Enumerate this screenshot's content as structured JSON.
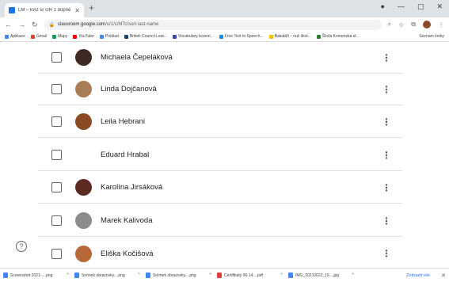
{
  "browser": {
    "tab_title": "LM – kvíz 5/ GR 1 dopne t",
    "address_host": "classroom.google.com",
    "address_path": "/u/1/c/MTc/sort-last-name",
    "bookmarks": [
      {
        "label": "Aplikace",
        "color": "#4285f4"
      },
      {
        "label": "Gmail",
        "color": "#db4437"
      },
      {
        "label": "Mapy",
        "color": "#0f9d58"
      },
      {
        "label": "YouTube",
        "color": "#ff0000"
      },
      {
        "label": "Preklad",
        "color": "#4285f4"
      },
      {
        "label": "British Council Lear...",
        "color": "#1a3c7a"
      },
      {
        "label": "Vocabulary lesson...",
        "color": "#3949ab"
      },
      {
        "label": "Free Text to Speech...",
        "color": "#1e88e5"
      },
      {
        "label": "Bakaláři – rezi škol...",
        "color": "#fbbc04"
      },
      {
        "label": "Škola Komenská st...",
        "color": "#2e7d32"
      }
    ],
    "bookmarks_right": "Seznam četby"
  },
  "students": [
    {
      "name": "Michaela Čepeláková",
      "avatar_color": "#3e2a22"
    },
    {
      "name": "Linda Dojčanová",
      "avatar_color": "#a97c58"
    },
    {
      "name": "Leila Hebrani",
      "avatar_color": "#8a4a24"
    },
    {
      "name": "Eduard Hrabal",
      "avatar_color": ""
    },
    {
      "name": "Karolína Jirsáková",
      "avatar_color": "#5b2a22"
    },
    {
      "name": "Marek Kalivoda",
      "avatar_color": "#8c8c8c"
    },
    {
      "name": "Eliška Kočišová",
      "avatar_color": "#b9683a"
    }
  ],
  "icons": {
    "more": "⋮",
    "help": "?"
  },
  "downloads": [
    {
      "label": "Screenshot 2021-....png",
      "type": "img"
    },
    {
      "label": "Snímek obrazovky....png",
      "type": "img"
    },
    {
      "label": "Snímek obrazovky....png",
      "type": "img"
    },
    {
      "label": "Certifikáty 06-14....pdf",
      "type": "pdf"
    },
    {
      "label": "IMG_20210622_15....jpg",
      "type": "img"
    }
  ],
  "downloads_show_all": "Zobrazit vše"
}
